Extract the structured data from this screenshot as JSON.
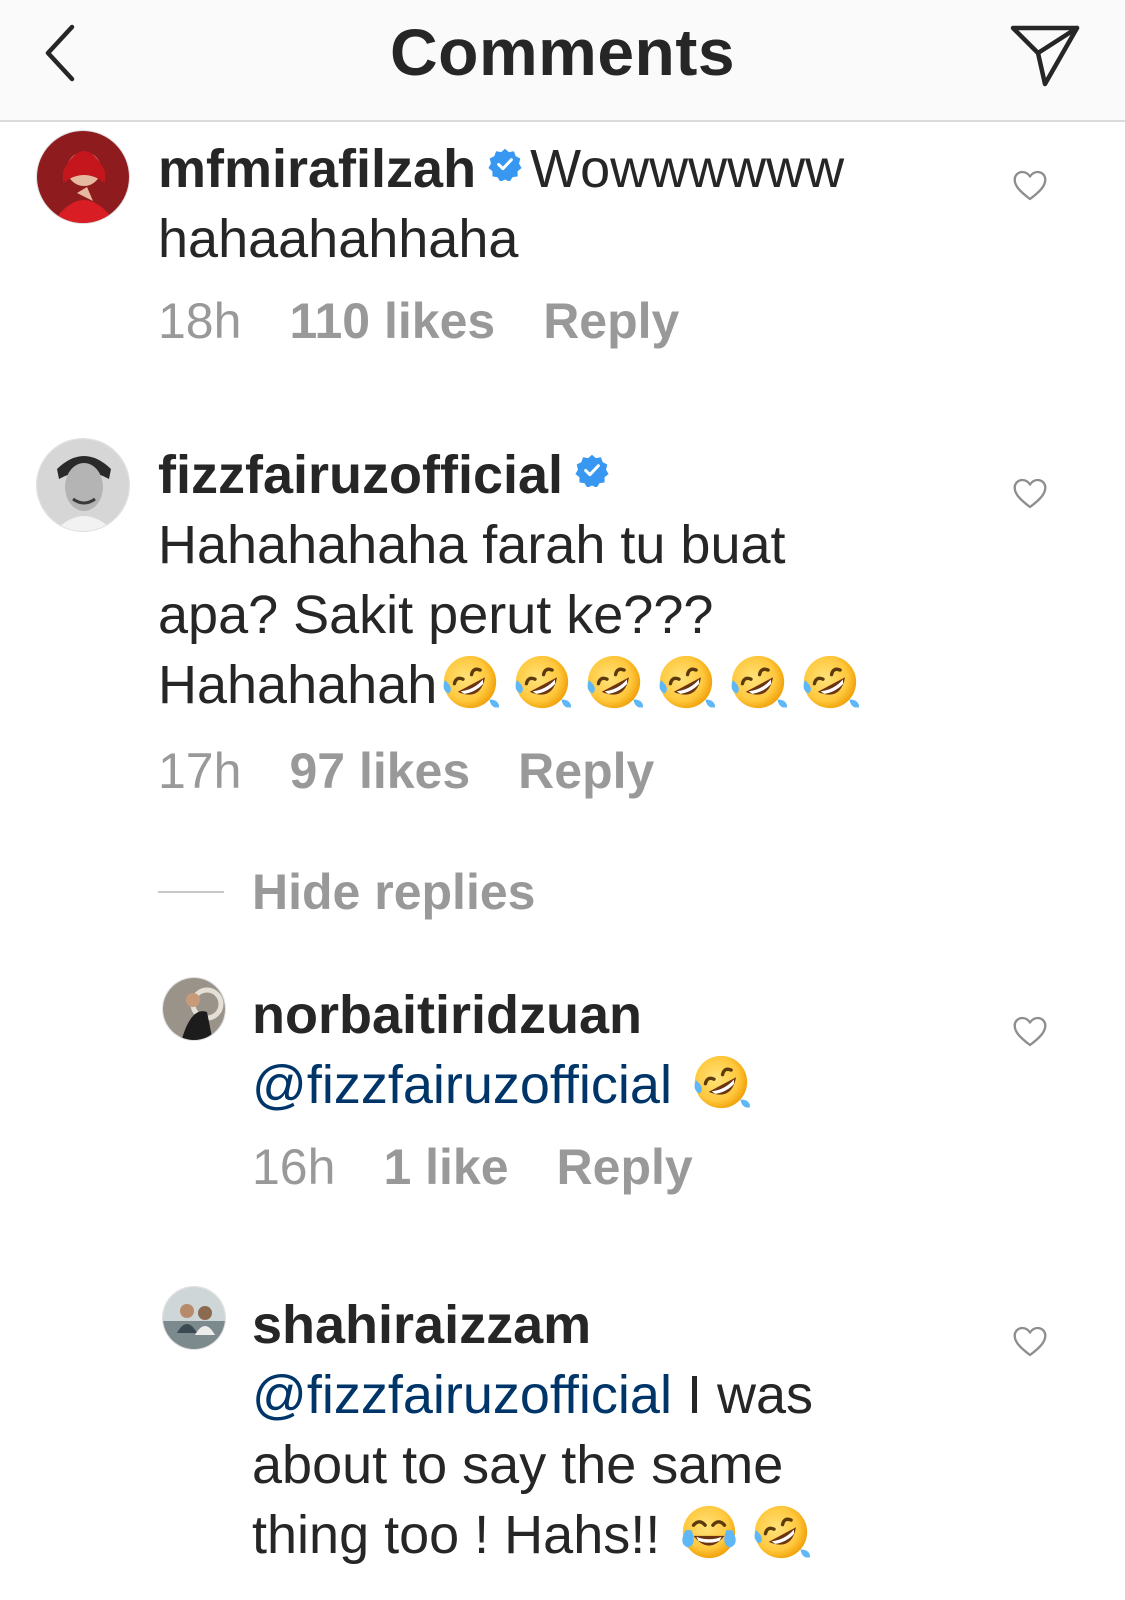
{
  "header": {
    "title": "Comments",
    "back_icon": "chevron-left-icon",
    "send_icon": "paper-plane-icon"
  },
  "comments": [
    {
      "username": "mfmirafilzah",
      "verified": true,
      "text_line1": "Wowwwwww",
      "text_line2": "hahaahahhaha",
      "time": "18h",
      "likes": "110 likes",
      "reply": "Reply"
    },
    {
      "username": "fizzfairuzofficial",
      "verified": true,
      "text_line1": "Hahahahaha farah tu buat",
      "text_line2": "apa? Sakit perut ke???",
      "text_line3": "Hahahahah",
      "emoji": "rolling-on-floor-laughing-emoji",
      "emoji_count": 6,
      "time": "17h",
      "likes": "97 likes",
      "reply": "Reply"
    }
  ],
  "hide_replies": "Hide replies",
  "replies": [
    {
      "username": "norbaitiridzuan",
      "mention": "@fizzfairuzofficial",
      "emoji": "rolling-on-floor-laughing-emoji",
      "time": "16h",
      "likes": "1 like",
      "reply": "Reply"
    },
    {
      "username": "shahiraizzam",
      "mention": "@fizzfairuzofficial",
      "text_line1": " I was",
      "text_line2": "about to say the same",
      "text_line3": "thing too ! Hahs!!",
      "emojis": [
        "face-with-tears-of-joy-emoji",
        "rolling-on-floor-laughing-emoji"
      ]
    }
  ],
  "colors": {
    "text": "#262626",
    "meta": "#999999",
    "mention": "#003569",
    "verified": "#3897f0",
    "header_bg": "#fafafa"
  }
}
